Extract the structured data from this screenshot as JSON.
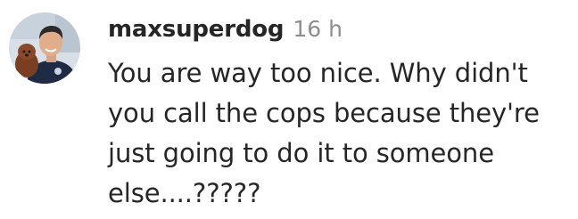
{
  "comment": {
    "username": "maxsuperdog",
    "timestamp": "16 h",
    "text_lines": [
      "You are way too nice. Why didn't",
      "you call the cops because they're",
      "just going to do it to someone",
      "else....?????"
    ]
  },
  "colors": {
    "text": "#262626",
    "muted": "#8e8e8e",
    "background": "#ffffff"
  }
}
